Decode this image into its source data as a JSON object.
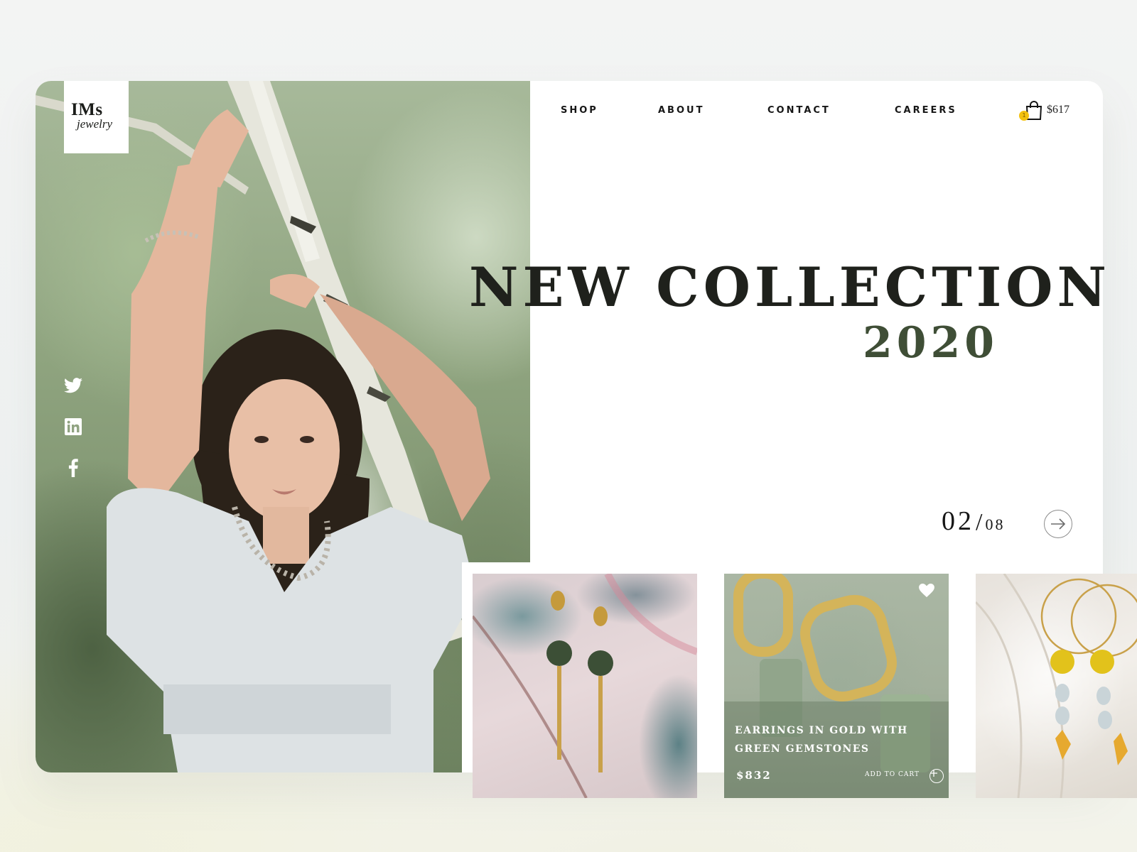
{
  "brand": {
    "name_line1": "IMs",
    "name_line2": "jewelry"
  },
  "nav": {
    "items": [
      "SHOP",
      "ABOUT",
      "CONTACT",
      "CAREERS"
    ]
  },
  "cart": {
    "count": "1",
    "total": "$617",
    "icon": "shopping-bag-icon",
    "badge_color": "#f3c10f"
  },
  "social": [
    {
      "icon": "twitter-icon"
    },
    {
      "icon": "linkedin-icon"
    },
    {
      "icon": "facebook-icon"
    }
  ],
  "hero": {
    "headline": "NEW COLLECTION",
    "year": "2020",
    "year_color": "#3f4e36"
  },
  "pager": {
    "current": "02",
    "separator": "/",
    "total": "08",
    "next_icon": "arrow-right-icon"
  },
  "products": [
    {
      "name": "",
      "price": ""
    },
    {
      "name": "Earrings in gold with green gemstones",
      "price": "$832",
      "add_label": "ADD TO CART",
      "favorite_icon": "heart-icon"
    },
    {
      "name": "",
      "price": ""
    }
  ]
}
